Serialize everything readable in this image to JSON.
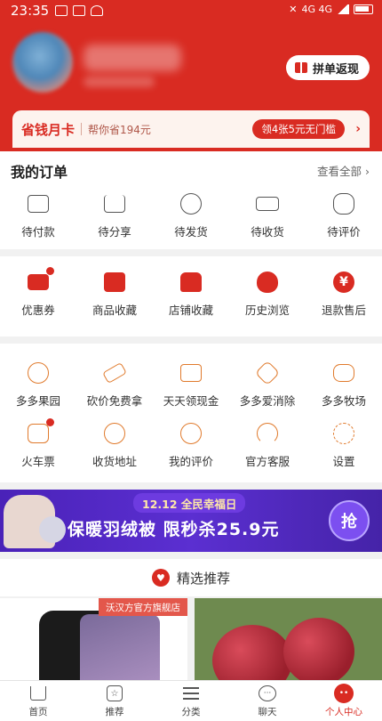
{
  "status_bar": {
    "time": "23:35",
    "network": "4G 4G"
  },
  "header": {
    "pin_button_label": "拼单返现",
    "card": {
      "title": "省钱月卡",
      "subtitle": "帮你省194元",
      "button": "领4张5元无门槛",
      "arrow": "›"
    }
  },
  "orders": {
    "title": "我的订单",
    "view_all": "查看全部 ›",
    "items": [
      {
        "label": "待付款",
        "icon": "wallet-icon"
      },
      {
        "label": "待分享",
        "icon": "share-icon"
      },
      {
        "label": "待发货",
        "icon": "clock-icon"
      },
      {
        "label": "待收货",
        "icon": "truck-icon"
      },
      {
        "label": "待评价",
        "icon": "review-icon"
      }
    ]
  },
  "tools1": {
    "items": [
      {
        "label": "优惠券",
        "icon": "coupon-icon",
        "badge": true
      },
      {
        "label": "商品收藏",
        "icon": "bag-heart-icon",
        "badge": false
      },
      {
        "label": "店铺收藏",
        "icon": "store-icon",
        "badge": false
      },
      {
        "label": "历史浏览",
        "icon": "footprint-icon",
        "badge": false
      },
      {
        "label": "退款售后",
        "icon": "refund-icon",
        "badge": false,
        "glyph": "¥"
      }
    ]
  },
  "tools2": {
    "row1": [
      {
        "label": "多多果园",
        "icon": "tree-icon"
      },
      {
        "label": "砍价免费拿",
        "icon": "axe-icon"
      },
      {
        "label": "天天领现金",
        "icon": "cash-icon"
      },
      {
        "label": "多多爱消除",
        "icon": "star-icon"
      },
      {
        "label": "多多牧场",
        "icon": "cow-icon"
      }
    ],
    "row2": [
      {
        "label": "火车票",
        "icon": "train-icon",
        "badge": true
      },
      {
        "label": "收货地址",
        "icon": "location-icon",
        "badge": false
      },
      {
        "label": "我的评价",
        "icon": "comment-icon",
        "badge": false
      },
      {
        "label": "官方客服",
        "icon": "headset-icon",
        "badge": false
      },
      {
        "label": "设置",
        "icon": "gear-icon",
        "badge": false
      }
    ]
  },
  "banner": {
    "top_text": "12.12 全民幸福日",
    "main_text": "保暖羽绒被 限秒杀25.9元",
    "grab_label": "抢"
  },
  "recommend": {
    "title": "精选推荐"
  },
  "products": [
    {
      "tag": "沃汉方官方旗舰店"
    }
  ],
  "tabbar": {
    "tabs": [
      {
        "label": "首页",
        "icon": "home-icon",
        "active": false
      },
      {
        "label": "推荐",
        "icon": "recommend-icon",
        "active": false
      },
      {
        "label": "分类",
        "icon": "category-icon",
        "active": false
      },
      {
        "label": "聊天",
        "icon": "chat-icon",
        "active": false
      },
      {
        "label": "个人中心",
        "icon": "profile-icon",
        "active": true
      }
    ]
  },
  "colors": {
    "brand": "#d92b22",
    "banner_purple": "#5b2fd1",
    "tool_orange": "#e07a2c"
  }
}
